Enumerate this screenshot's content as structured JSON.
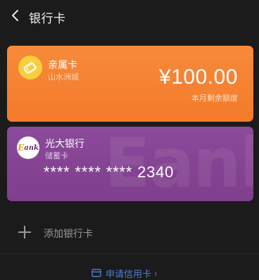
{
  "header": {
    "title": "银行卡",
    "back_icon": "chevron-left-icon"
  },
  "family_card": {
    "name": "亲属卡",
    "subtitle": "山水洲城",
    "amount": "¥100.00",
    "amount_label": "本月剩余额度",
    "logo_icon": "family-card-logo-icon",
    "colors": {
      "background": "#f47b2b",
      "logo": "#f8cf3c"
    }
  },
  "bank_card": {
    "name": "光大银行",
    "type": "储蓄卡",
    "number": "**** **** **** 2340",
    "logo_text_e": "E",
    "logo_text_rest": "ank",
    "watermark": "Eank",
    "colors": {
      "background": "#7f3f8d",
      "logo_e": "#e3a31a"
    }
  },
  "add_card": {
    "label": "添加银行卡",
    "icon": "plus-icon"
  },
  "apply_credit": {
    "label": "申请信用卡",
    "chevron": "›",
    "icon": "credit-card-icon",
    "color": "#4c7fd0"
  }
}
